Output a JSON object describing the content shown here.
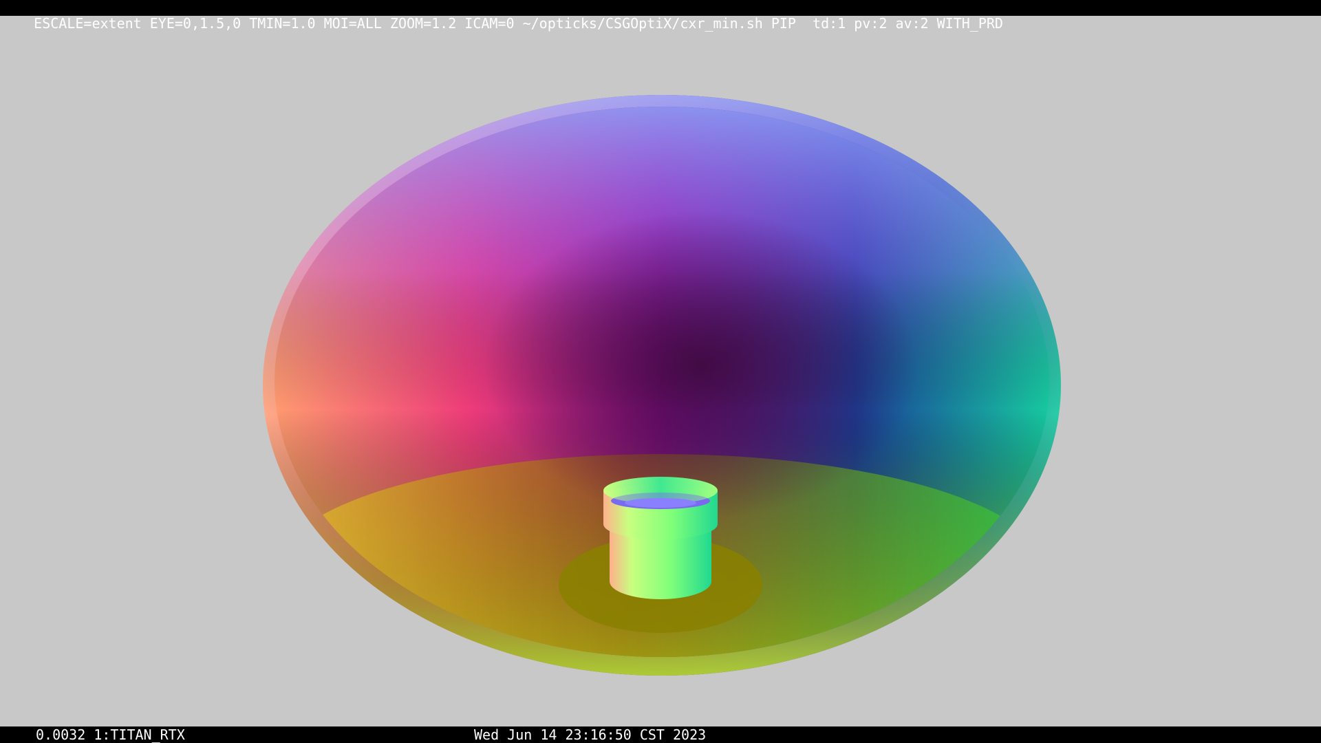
{
  "topbar": {
    "text": "ESCALE=extent EYE=0,1.5,0 TMIN=1.0 MOI=ALL ZOOM=1.2 ICAM=0 ~/opticks/CSGOptiX/cxr_min.sh PIP  td:1 pv:2 av:2 WITH_PRD"
  },
  "bottombar": {
    "left_text": "0.0032 1:TITAN_RTX",
    "center_text": "Wed Jun 14 23:16:50 CST 2023"
  },
  "scene": {
    "background_color": "#c8c8c8",
    "objects": [
      "disc-outer",
      "disc-inner",
      "cylinder-object",
      "shadow"
    ]
  }
}
